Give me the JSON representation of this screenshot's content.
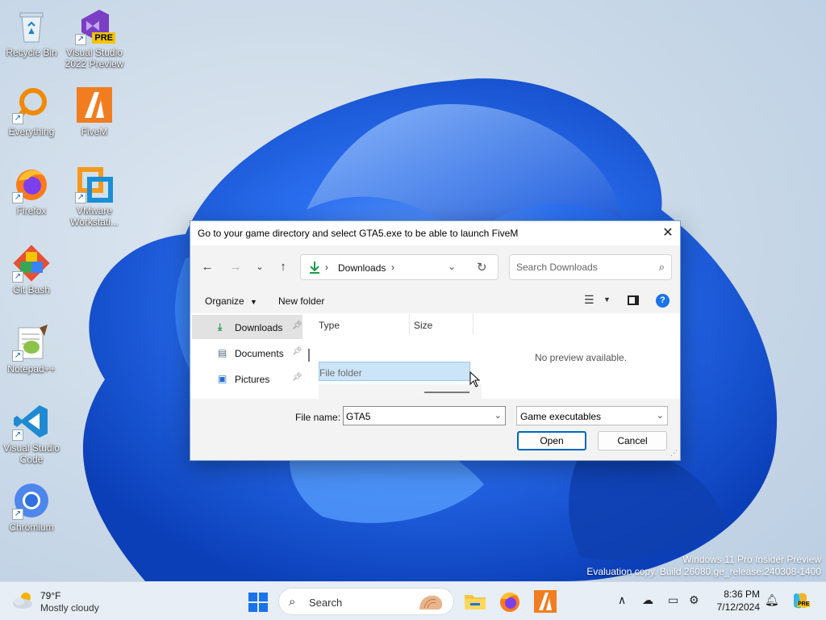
{
  "desktop": {
    "icons": [
      {
        "label": "Recycle Bin"
      },
      {
        "label": "Visual Studio 2022 Preview",
        "badge": "PRE"
      },
      {
        "label": "Everything"
      },
      {
        "label": "FiveM"
      },
      {
        "label": "Firefox"
      },
      {
        "label": "VMware Workstati..."
      },
      {
        "label": "Git Bash"
      },
      {
        "label": "Notepad++"
      },
      {
        "label": "Visual Studio Code"
      },
      {
        "label": "Chromium"
      }
    ],
    "watermark": {
      "line1": "Windows 11 Pro Insider Preview",
      "line2": "Evaluation copy. Build 26080.ge_release.240308-1400"
    }
  },
  "dialog": {
    "title": "Go to your game directory and select GTA5.exe to be able to launch FiveM",
    "address": {
      "location": "Downloads"
    },
    "search": {
      "placeholder": "Search Downloads"
    },
    "toolbar": {
      "organize": "Organize",
      "new_folder": "New folder"
    },
    "nav_pane": {
      "items": [
        {
          "label": "Downloads",
          "selected": true
        },
        {
          "label": "Documents"
        },
        {
          "label": "Pictures"
        }
      ]
    },
    "columns": [
      "Type",
      "Size"
    ],
    "rows": [
      {
        "type": "File folder",
        "selected": true
      }
    ],
    "preview": {
      "message": "No preview available."
    },
    "footer": {
      "file_name_label": "File name:",
      "file_name_value": "GTA5",
      "file_type": "Game executables",
      "open": "Open",
      "cancel": "Cancel"
    }
  },
  "taskbar": {
    "weather": {
      "temp": "79°F",
      "condition": "Mostly cloudy"
    },
    "search_label": "Search",
    "clock": {
      "time": "8:36 PM",
      "date": "7/12/2024"
    },
    "copilot_badge": "PRE"
  },
  "colors": {
    "accent": "#0067c0",
    "selection": "#cce4f7",
    "wallpaper_blue": "#1e5fd9"
  }
}
